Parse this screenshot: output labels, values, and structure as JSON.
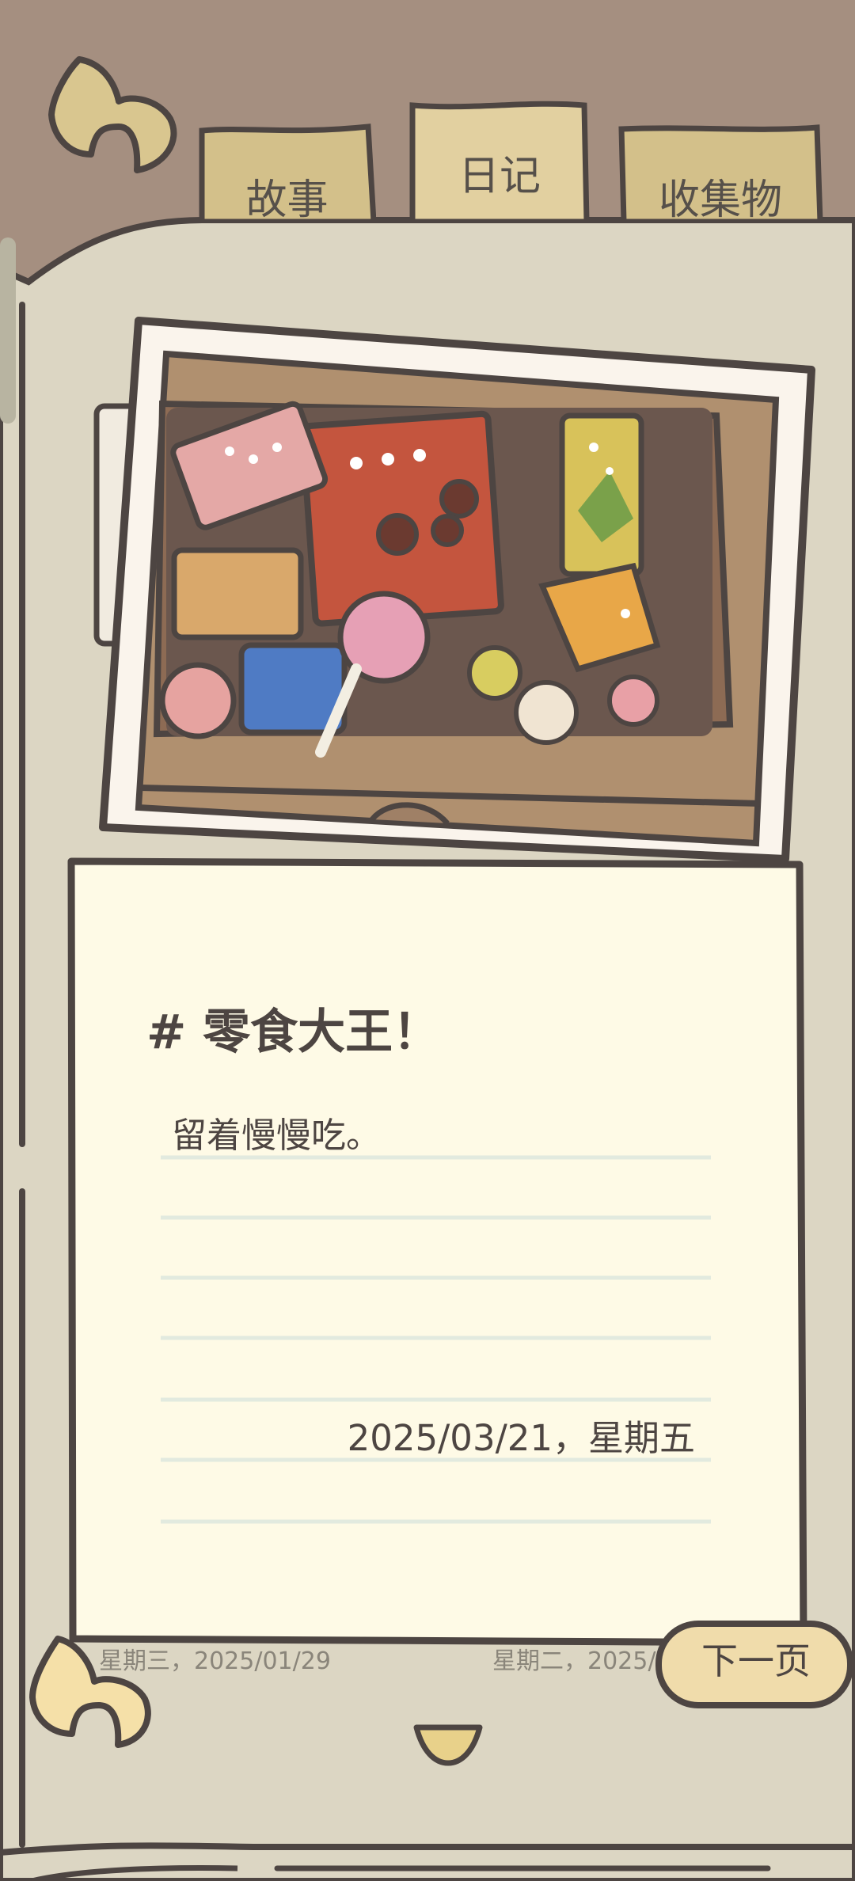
{
  "tabs": [
    {
      "label": "故事"
    },
    {
      "label": "日记"
    },
    {
      "label": "收集物"
    }
  ],
  "active_tab": "日记",
  "entry": {
    "title": "# 零食大王！",
    "body": "留着慢慢吃。",
    "date": "2025/03/21，星期五"
  },
  "navigation": {
    "prev_hint": "星期三，2025/01/29",
    "next_hint": "星期二，2025/",
    "next_label": "下一页"
  },
  "colors": {
    "background": "#a58f80",
    "page": "#dcd6c3",
    "paper": "#fefae6",
    "outline": "#4d4542",
    "tab": "#d3c08a",
    "tab_active": "#e2d0a0",
    "button": "#f0dcab"
  },
  "icons": [
    "back-arrow-icon",
    "prev-page-arrow-icon",
    "bookmark-icon"
  ]
}
